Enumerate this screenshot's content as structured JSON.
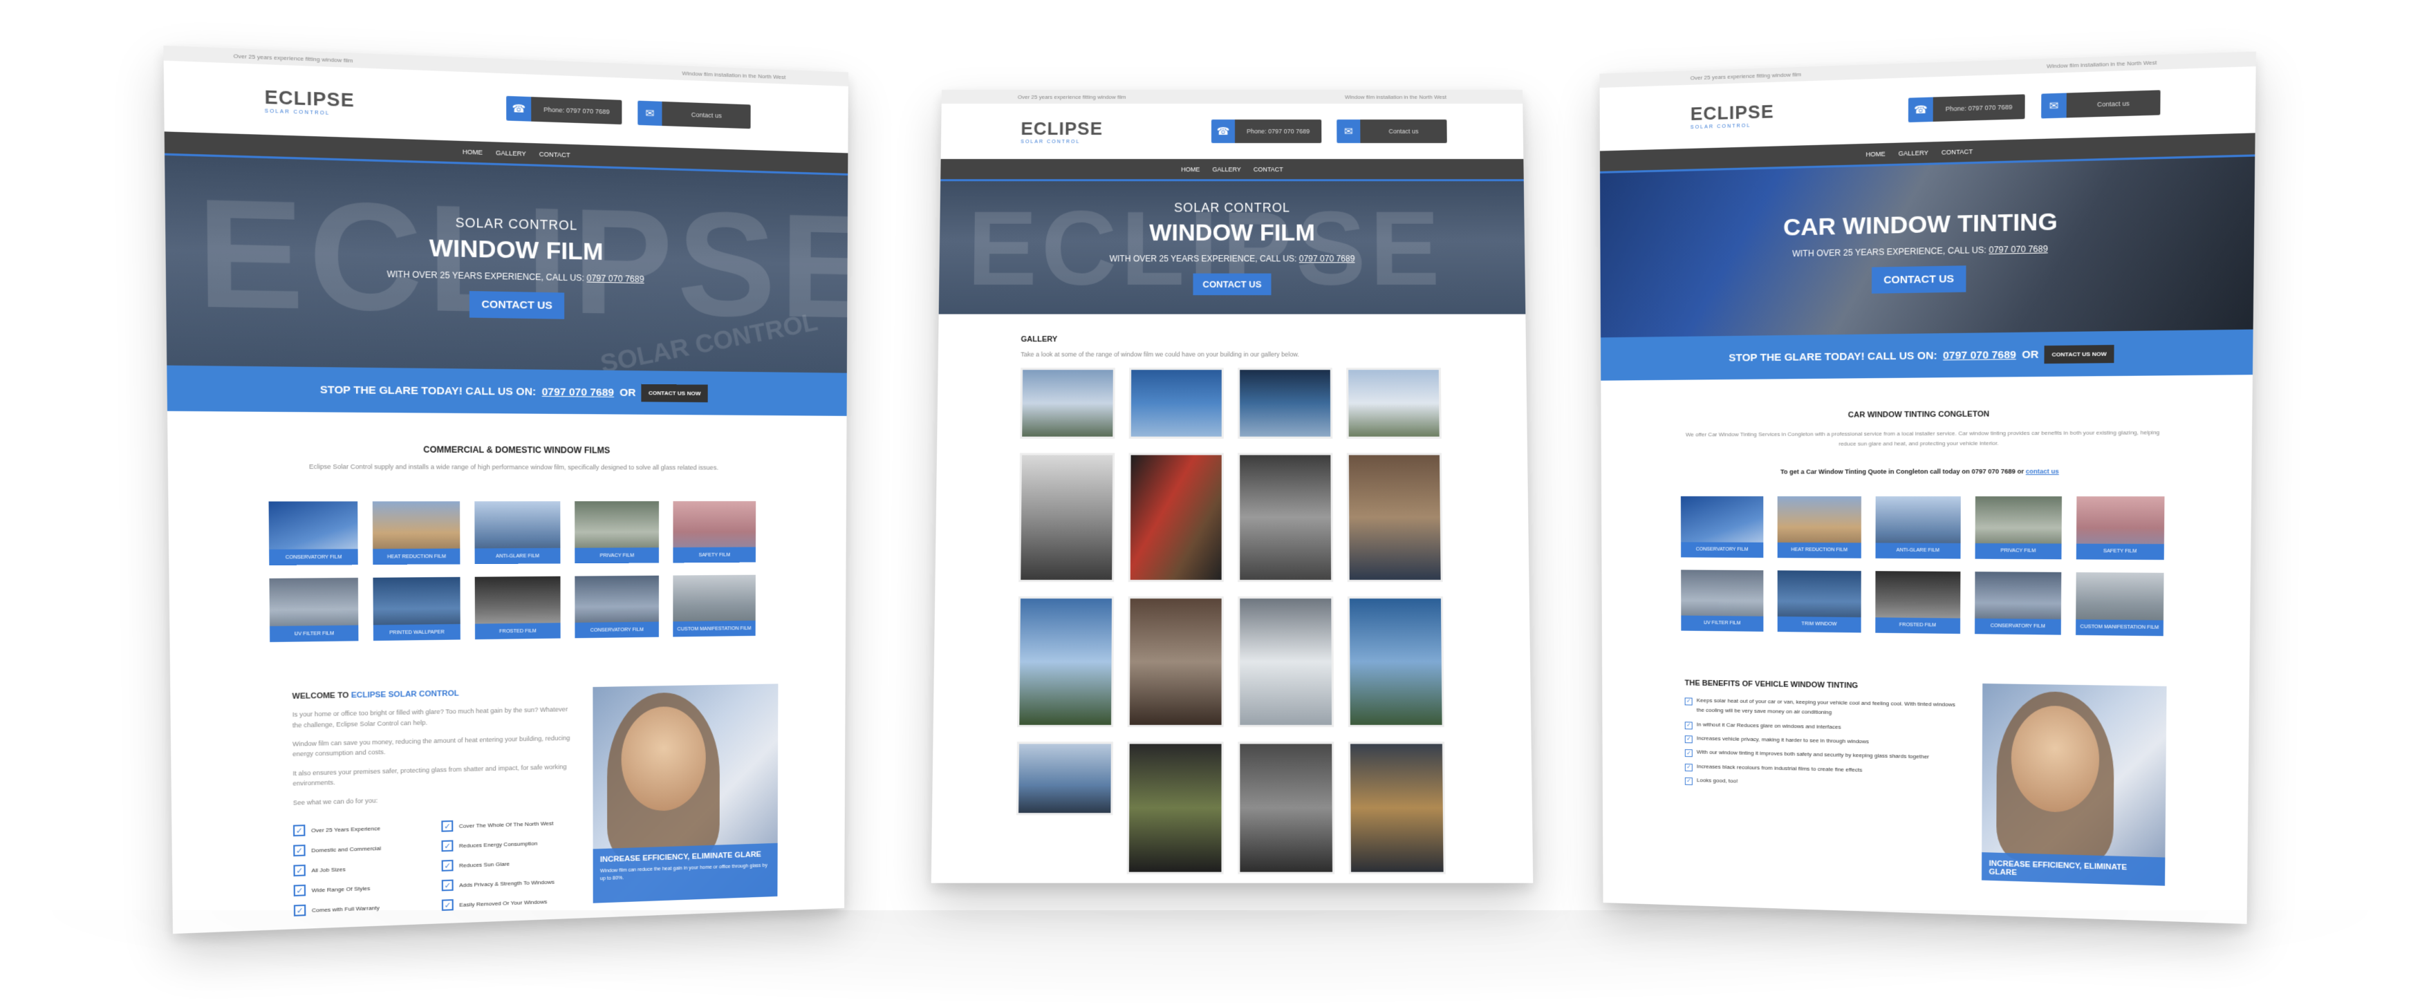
{
  "colors": {
    "accent": "#3a7bd5",
    "nav": "#444444",
    "cta": "#3f83d6"
  },
  "site": {
    "logo": "ECLIPSE",
    "logo_sub": "SOLAR CONTROL",
    "topbar_left": "Over 25 years experience fitting window film",
    "topbar_right": "Window film installation in the North West",
    "phone_label": "Phone: 0797 070 7689",
    "email_label": "Contact us",
    "phone_icon": "phone-icon",
    "email_icon": "envelope-icon",
    "nav": [
      "HOME",
      "GALLERY",
      "CONTACT"
    ]
  },
  "left": {
    "hero_kicker": "SOLAR CONTROL",
    "hero_title": "WINDOW FILM",
    "hero_sub_prefix": "WITH OVER 25 YEARS EXPERIENCE, CALL US:",
    "hero_phone": "0797 070 7689",
    "hero_button": "CONTACT US",
    "watermark": "ECLIPSE",
    "watermark_sub": "SOLAR CONTROL",
    "cta_text": "STOP THE GLARE TODAY! CALL US ON:",
    "cta_phone": "0797 070 7689",
    "cta_or": "OR",
    "cta_button": "CONTACT US NOW",
    "section_title": "COMMERCIAL & DOMESTIC WINDOW FILMS",
    "section_text": "Eclipse Solar Control supply and installs a wide range of high performance window film, specifically designed to solve all glass related issues.",
    "tiles": [
      "CONSERVATORY FILM",
      "HEAT REDUCTION FILM",
      "ANTI-GLARE FILM",
      "PRIVACY FILM",
      "SAFETY FILM",
      "UV FILTER FILM",
      "PRINTED WALLPAPER",
      "FROSTED FILM",
      "CONSERVATORY FILM",
      "CUSTOM MANIFESTATION FILM"
    ],
    "welcome_prefix": "WELCOME TO",
    "welcome_brand": "ECLIPSE SOLAR CONTROL",
    "welcome_p1": "Is your home or office too bright or filled with glare? Too much heat gain by the sun? Whatever the challenge, Eclipse Solar Control can help.",
    "welcome_p2": "Window film can save you money, reducing the amount of heat entering your building, reducing energy consumption and costs.",
    "welcome_p3": "It also ensures your premises safer, protecting glass from shatter and impact, for safe working environments.",
    "welcome_p4": "See what we can do for you:",
    "checks": [
      "Over 25 Years Experience",
      "Domestic and Commercial",
      "All Job Sizes",
      "Wide Range Of Styles",
      "Comes with Full Warranty",
      "Cover The Whole Of The North West",
      "Reduces Energy Consumption",
      "Reduces Sun Glare",
      "Adds Privacy & Strength To Windows",
      "Easily Removed Or Your Windows"
    ],
    "promo_title": "INCREASE EFFICIENCY, ELIMINATE GLARE",
    "promo_text": "Window film can reduce the heat gain in your home or office through glass by up to 80%."
  },
  "middle": {
    "hero_kicker": "SOLAR CONTROL",
    "hero_title": "WINDOW FILM",
    "hero_sub_prefix": "WITH OVER 25 YEARS EXPERIENCE, CALL US:",
    "hero_phone": "0797 070 7689",
    "hero_button": "CONTACT US",
    "gallery_title": "GALLERY",
    "gallery_text": "Take a look at some of the range of window film we could have on your building in our gallery below."
  },
  "right": {
    "hero_title": "CAR WINDOW TINTING",
    "hero_sub_prefix": "WITH OVER 25 YEARS EXPERIENCE, CALL US:",
    "hero_phone": "0797 070 7689",
    "hero_button": "CONTACT US",
    "cta_text": "STOP THE GLARE TODAY! CALL US ON:",
    "cta_phone": "0797 070 7689",
    "cta_or": "OR",
    "cta_button": "CONTACT US NOW",
    "section_title": "CAR WINDOW TINTING CONGLETON",
    "section_text": "We offer Car Window Tinting Services in Congleton with a professional service from a local installer service. Car window tinting provides car benefits in both your existing glazing, helping reduce sun glare and heat, and protecting your vehicle interior.",
    "quote_prefix": "To get a Car Window Tinting Quote in Congleton call today on 0797 070 7689 or",
    "quote_link": "contact us",
    "tiles": [
      "CONSERVATORY FILM",
      "HEAT REDUCTION FILM",
      "ANTI-GLARE FILM",
      "PRIVACY FILM",
      "SAFETY FILM",
      "UV FILTER FILM",
      "TRIM WINDOW",
      "FROSTED FILM",
      "CONSERVATORY FILM",
      "CUSTOM MANIFESTATION FILM"
    ],
    "benefits_title": "THE BENEFITS OF VEHICLE WINDOW TINTING",
    "benefits": [
      "Keeps solar heat out of your car or van, keeping your vehicle cool and feeling cool. With tinted windows the cooling will be very save money on air conditioning",
      "In without it Car Reduces glare on windows and interfaces",
      "Increases vehicle privacy, making it harder to see in through windows",
      "With our window tinting it improves both safety and security by keeping glass shards together",
      "Increases black recolours from industrial films to create fine effects",
      "Looks good, too!"
    ],
    "promo_title": "INCREASE EFFICIENCY, ELIMINATE GLARE"
  }
}
